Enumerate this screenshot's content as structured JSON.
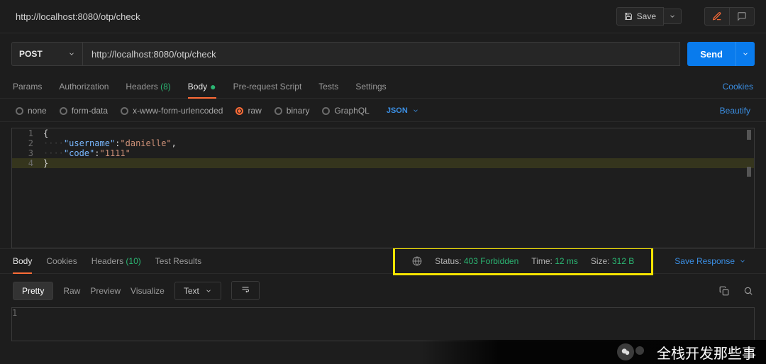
{
  "title": "http://localhost:8080/otp/check",
  "toolbar": {
    "save_label": "Save"
  },
  "request": {
    "method": "POST",
    "url": "http://localhost:8080/otp/check",
    "send_label": "Send"
  },
  "req_tabs": {
    "items": [
      {
        "label": "Params"
      },
      {
        "label": "Authorization"
      },
      {
        "label": "Headers",
        "count": "(8)"
      },
      {
        "label": "Body",
        "dot": "●",
        "active": true
      },
      {
        "label": "Pre-request Script"
      },
      {
        "label": "Tests"
      },
      {
        "label": "Settings"
      }
    ],
    "cookies": "Cookies"
  },
  "body_types": {
    "options": [
      {
        "label": "none"
      },
      {
        "label": "form-data"
      },
      {
        "label": "x-www-form-urlencoded"
      },
      {
        "label": "raw",
        "selected": true
      },
      {
        "label": "binary"
      },
      {
        "label": "GraphQL"
      }
    ],
    "language": "JSON",
    "beautify": "Beautify"
  },
  "editor": {
    "lines": [
      {
        "n": "1",
        "raw": "{",
        "tokens": [
          [
            "brace",
            "{"
          ]
        ]
      },
      {
        "n": "2",
        "raw": "    \"username\":\"danielle\",",
        "tokens": [
          [
            "indent",
            "····"
          ],
          [
            "key",
            "\"username\""
          ],
          [
            "punc",
            ":"
          ],
          [
            "str",
            "\"danielle\""
          ],
          [
            "punc",
            ","
          ]
        ]
      },
      {
        "n": "3",
        "raw": "    \"code\":\"1111\"",
        "tokens": [
          [
            "indent",
            "····"
          ],
          [
            "key",
            "\"code\""
          ],
          [
            "punc",
            ":"
          ],
          [
            "str",
            "\"1111\""
          ]
        ]
      },
      {
        "n": "4",
        "raw": "}",
        "tokens": [
          [
            "brace",
            "}"
          ]
        ],
        "hl": true
      }
    ]
  },
  "resp_tabs": {
    "items": [
      {
        "label": "Body",
        "active": true
      },
      {
        "label": "Cookies"
      },
      {
        "label": "Headers",
        "count": "(10)"
      },
      {
        "label": "Test Results"
      }
    ],
    "status_label": "Status:",
    "status_value": "403 Forbidden",
    "time_label": "Time:",
    "time_value": "12 ms",
    "size_label": "Size:",
    "size_value": "312 B",
    "save_response": "Save Response"
  },
  "resp_fmt": {
    "items": [
      {
        "label": "Pretty",
        "active": true
      },
      {
        "label": "Raw"
      },
      {
        "label": "Preview"
      },
      {
        "label": "Visualize"
      }
    ],
    "lang": "Text"
  },
  "resp_body": {
    "line1_n": "1",
    "line1_text": ""
  },
  "watermark": "全栈开发那些事",
  "colors": {
    "accent": "#097bed",
    "orange": "#ff6c37",
    "green": "#2bb673",
    "highlight_border": "#f5e400"
  }
}
